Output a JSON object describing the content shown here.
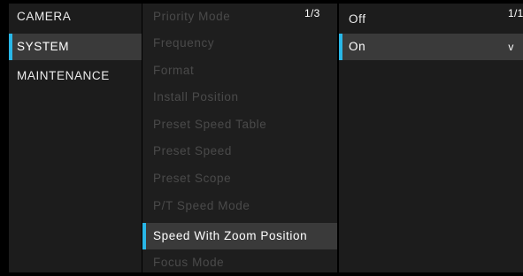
{
  "menu": [
    {
      "label": "CAMERA",
      "selected": false
    },
    {
      "label": "SYSTEM",
      "selected": true
    },
    {
      "label": "MAINTENANCE",
      "selected": false
    }
  ],
  "submenu": {
    "page": "1/3",
    "items": [
      {
        "label": "Priority Mode",
        "enabled": false
      },
      {
        "label": "Frequency",
        "enabled": false
      },
      {
        "label": "Format",
        "enabled": false
      },
      {
        "label": "Install Position",
        "enabled": false
      },
      {
        "label": "Preset Speed Table",
        "enabled": false
      },
      {
        "label": "Preset Speed",
        "enabled": false
      },
      {
        "label": "Preset Scope",
        "enabled": false
      },
      {
        "label": "P/T Speed Mode",
        "enabled": false
      },
      {
        "label": "Speed With Zoom Position",
        "enabled": true,
        "selected": true
      },
      {
        "label": "Focus Mode",
        "enabled": false
      }
    ]
  },
  "options": {
    "page": "1/1",
    "items": [
      {
        "label": "Off",
        "selected": false
      },
      {
        "label": "On",
        "selected": true,
        "mark": "v"
      }
    ]
  },
  "colors": {
    "accent": "#29b7e8",
    "panel": "#1c1c1c",
    "selected_row": "#3a3a3a",
    "disabled_text": "#4a4a4a",
    "enabled_text": "#ececec"
  }
}
